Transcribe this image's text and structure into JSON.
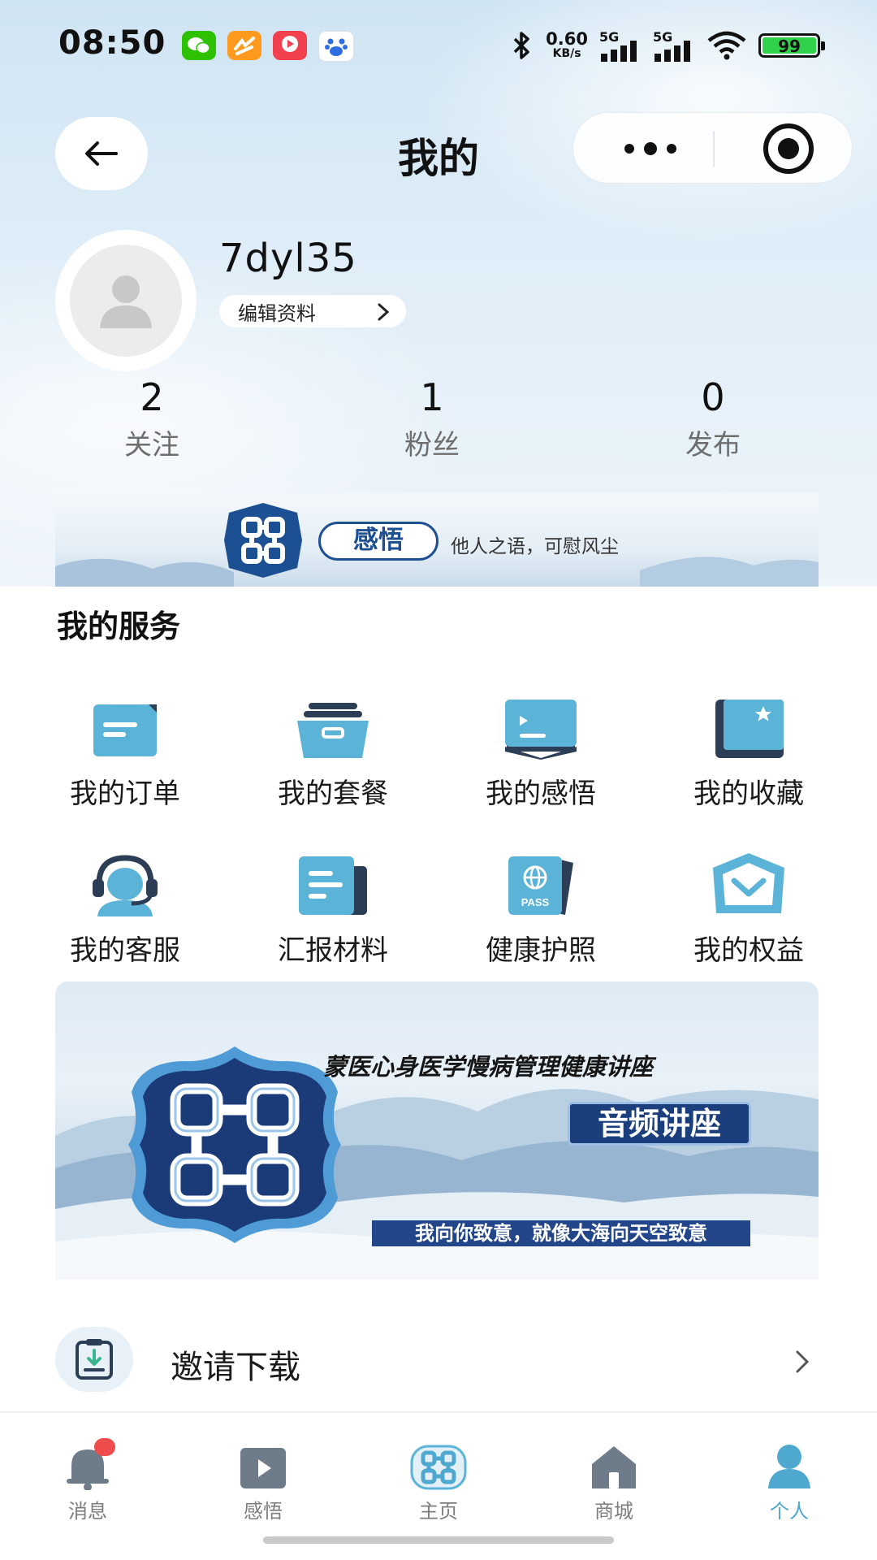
{
  "status_bar": {
    "time": "08:50",
    "network_speed": "0.60",
    "network_unit": "KB/s",
    "signal1": "5G",
    "signal2": "5G",
    "battery": "99",
    "app_icons": [
      "wechat-icon",
      "app-orange-icon",
      "video-app-icon",
      "baidu-icon"
    ]
  },
  "nav": {
    "title": "我的"
  },
  "profile": {
    "username": "7dyl35",
    "edit_label": "编辑资料"
  },
  "stats": [
    {
      "value": "2",
      "label": "关注"
    },
    {
      "value": "1",
      "label": "粉丝"
    },
    {
      "value": "0",
      "label": "发布"
    }
  ],
  "banner_ganwu": {
    "title": "感悟",
    "subtitle": "他人之语，可慰风尘"
  },
  "services": {
    "title": "我的服务",
    "items": [
      {
        "label": "我的订单",
        "icon": "order-card-icon"
      },
      {
        "label": "我的套餐",
        "icon": "package-box-icon"
      },
      {
        "label": "我的感悟",
        "icon": "reflection-book-icon"
      },
      {
        "label": "我的收藏",
        "icon": "favorite-book-icon"
      },
      {
        "label": "我的客服",
        "icon": "customer-service-icon"
      },
      {
        "label": "汇报材料",
        "icon": "report-document-icon"
      },
      {
        "label": "健康护照",
        "icon": "passport-icon"
      },
      {
        "label": "我的权益",
        "icon": "crown-icon"
      }
    ],
    "passport_text": "PASS"
  },
  "lecture_banner": {
    "title": "蒙医心身医学慢病管理健康讲座",
    "tag": "音频讲座",
    "bottom_text": "我向你致意，就像大海向天空致意"
  },
  "invite": {
    "label": "邀请下载"
  },
  "tabbar": [
    {
      "label": "消息",
      "icon": "bell-icon",
      "active": false
    },
    {
      "label": "感悟",
      "icon": "play-icon",
      "active": false
    },
    {
      "label": "主页",
      "icon": "knot-logo-icon",
      "active": false
    },
    {
      "label": "商城",
      "icon": "store-icon",
      "active": false
    },
    {
      "label": "个人",
      "icon": "person-icon",
      "active": true
    }
  ],
  "colors": {
    "accent": "#4fa8cf",
    "icon_teal": "#5bb4d8",
    "icon_dark": "#2c3e55",
    "brand_navy": "#1d4f93",
    "badge": "#ef4d4d"
  }
}
